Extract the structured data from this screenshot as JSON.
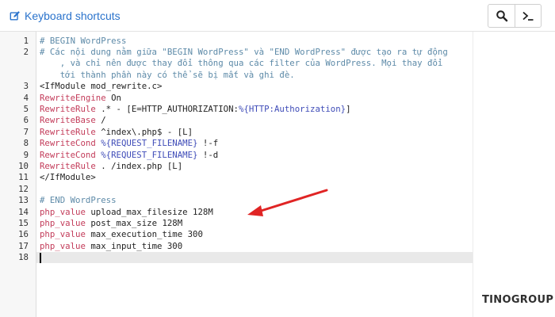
{
  "toolbar": {
    "keyboard_shortcuts": "Keyboard shortcuts",
    "search_icon": "search-icon",
    "terminal_icon": "terminal-icon",
    "accent": "#2a73cc"
  },
  "editor": {
    "cursor_line": 18,
    "lines": [
      {
        "n": "1",
        "text": "# BEGIN WordPress",
        "type": "comment"
      },
      {
        "n": "2",
        "text": "# Các nội dung nằm giữa \"BEGIN WordPress\" và \"END WordPress\" được tạo ra tự động",
        "type": "comment"
      },
      {
        "n": "",
        "text": "    , và chỉ nên được thay đổi thông qua các filter của WordPress. Mọi thay đổi",
        "type": "comment"
      },
      {
        "n": "",
        "text": "    tới thành phần này có thể sẽ bị mất và ghi đè.",
        "type": "comment"
      },
      {
        "n": "3",
        "text": "<IfModule mod_rewrite.c>",
        "type": "text"
      },
      {
        "n": "4",
        "text": "RewriteEngine On",
        "type": "directive",
        "kw": "RewriteEngine",
        "rest": " On"
      },
      {
        "n": "5",
        "text": "RewriteRule .* - [E=HTTP_AUTHORIZATION:%{HTTP:Authorization}]",
        "type": "directive",
        "kw": "RewriteRule",
        "rest": " .* - [E=HTTP_AUTHORIZATION:%{HTTP:Authorization}]"
      },
      {
        "n": "6",
        "text": "RewriteBase /",
        "type": "directive",
        "kw": "RewriteBase",
        "rest": " /"
      },
      {
        "n": "7",
        "text": "RewriteRule ^index\\.php$ - [L]",
        "type": "directive",
        "kw": "RewriteRule",
        "rest": " ^index\\.php$ - [L]"
      },
      {
        "n": "8",
        "text": "RewriteCond %{REQUEST_FILENAME} !-f",
        "type": "directive",
        "kw": "RewriteCond",
        "rest": " %{REQUEST_FILENAME} !-f"
      },
      {
        "n": "9",
        "text": "RewriteCond %{REQUEST_FILENAME} !-d",
        "type": "directive",
        "kw": "RewriteCond",
        "rest": " %{REQUEST_FILENAME} !-d"
      },
      {
        "n": "10",
        "text": "RewriteRule . /index.php [L]",
        "type": "directive",
        "kw": "RewriteRule",
        "rest": " . /index.php [L]"
      },
      {
        "n": "11",
        "text": "</IfModule>",
        "type": "text"
      },
      {
        "n": "12",
        "text": "",
        "type": "text"
      },
      {
        "n": "13",
        "text": "# END WordPress",
        "type": "comment"
      },
      {
        "n": "14",
        "text": "php_value upload_max_filesize 128M",
        "type": "directive",
        "kw": "php_value",
        "rest": " upload_max_filesize 128M"
      },
      {
        "n": "15",
        "text": "php_value post_max_size 128M",
        "type": "directive",
        "kw": "php_value",
        "rest": " post_max_size 128M"
      },
      {
        "n": "16",
        "text": "php_value max_execution_time 300",
        "type": "directive",
        "kw": "php_value",
        "rest": " max_execution_time 300"
      },
      {
        "n": "17",
        "text": "php_value max_input_time 300",
        "type": "directive",
        "kw": "php_value",
        "rest": " max_input_time 300"
      },
      {
        "n": "18",
        "text": "",
        "type": "text"
      }
    ]
  },
  "watermark": "TINOGROUP",
  "colors": {
    "comment": "#5d8aa8",
    "keyword": "#c33c5a",
    "arrow": "#e02424",
    "active_line": "#e9e9e9"
  }
}
